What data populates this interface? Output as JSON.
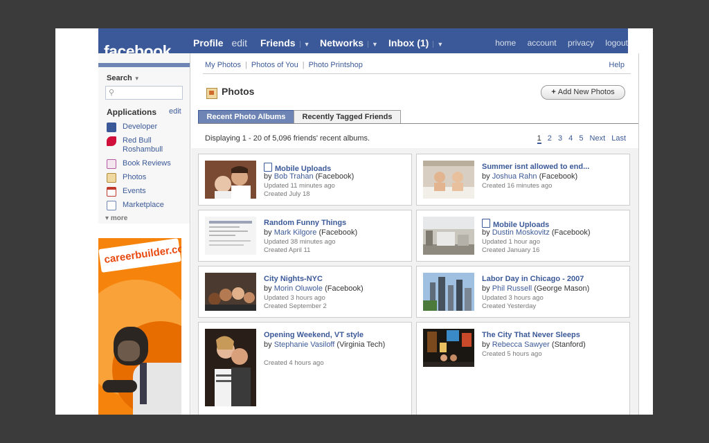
{
  "header": {
    "logo": "facebook",
    "nav": {
      "profile": "Profile",
      "edit": "edit",
      "friends": "Friends",
      "networks": "Networks",
      "inbox": "Inbox (1)",
      "dropdown_glyph": "▼"
    },
    "links": [
      "home",
      "account",
      "privacy",
      "logout"
    ]
  },
  "sidebar": {
    "search_label": "Search",
    "search_placeholder": "",
    "applications_label": "Applications",
    "applications_edit": "edit",
    "apps": [
      {
        "label": "Developer",
        "icon": "developer-icon",
        "color": "#3b5998"
      },
      {
        "label": "Red Bull Roshambull",
        "icon": "red-bull-icon",
        "color": "#d0103a"
      },
      {
        "label": "Book Reviews",
        "icon": "book-icon",
        "color": "#b45aa0"
      },
      {
        "label": "Photos",
        "icon": "photos-icon",
        "color": "#d06b2e"
      },
      {
        "label": "Events",
        "icon": "calendar-icon",
        "color": "#c0392b"
      },
      {
        "label": "Marketplace",
        "icon": "marketplace-icon",
        "color": "#6d84b4"
      }
    ],
    "more": "more"
  },
  "ad": {
    "brand": "careerbuilder.com"
  },
  "photos": {
    "subnav": [
      "My Photos",
      "Photos of You",
      "Photo Printshop"
    ],
    "help": "Help",
    "title": "Photos",
    "add_button": "Add New Photos",
    "tabs": {
      "active": "Recent Photo Albums",
      "inactive": "Recently Tagged Friends"
    },
    "displaying": "Displaying 1 - 20 of 5,096 friends' recent albums.",
    "pager": {
      "current": "1",
      "pages": [
        "2",
        "3",
        "4",
        "5"
      ],
      "next": "Next",
      "last": "Last"
    },
    "albums": [
      {
        "title": "Mobile Uploads",
        "mobile": true,
        "by": "by",
        "author": "Bob Trahan",
        "network": "(Facebook)",
        "updated": "Updated 11 minutes ago",
        "created": "Created July 18"
      },
      {
        "title": "Summer isnt allowed to end...",
        "mobile": false,
        "by": "by",
        "author": "Joshua Rahn",
        "network": "(Facebook)",
        "updated": "",
        "created": "Created 16 minutes ago"
      },
      {
        "title": "Random Funny Things",
        "mobile": false,
        "by": "by",
        "author": "Mark Kilgore",
        "network": "(Facebook)",
        "updated": "Updated 38 minutes ago",
        "created": "Created April 11"
      },
      {
        "title": "Mobile Uploads",
        "mobile": true,
        "by": "by",
        "author": "Dustin Moskovitz",
        "network": "(Facebook)",
        "updated": "Updated 1 hour ago",
        "created": "Created January 16"
      },
      {
        "title": "City Nights-NYC",
        "mobile": false,
        "by": "by",
        "author": "Morin Oluwole",
        "network": "(Facebook)",
        "updated": "Updated 3 hours ago",
        "created": "Created September 2"
      },
      {
        "title": "Labor Day in Chicago - 2007",
        "mobile": false,
        "by": "by",
        "author": "Phil Russell",
        "network": "(George Mason)",
        "updated": "Updated 3 hours ago",
        "created": "Created Yesterday"
      },
      {
        "title": "Opening Weekend, VT style",
        "mobile": false,
        "by": "by",
        "author": "Stephanie Vasiloff",
        "network": "(Virginia Tech)",
        "updated": "",
        "created": "Created 4 hours ago"
      },
      {
        "title": "The City That Never Sleeps",
        "mobile": false,
        "by": "by",
        "author": "Rebecca Sawyer",
        "network": "(Stanford)",
        "updated": "",
        "created": "Created 5 hours ago"
      }
    ]
  }
}
